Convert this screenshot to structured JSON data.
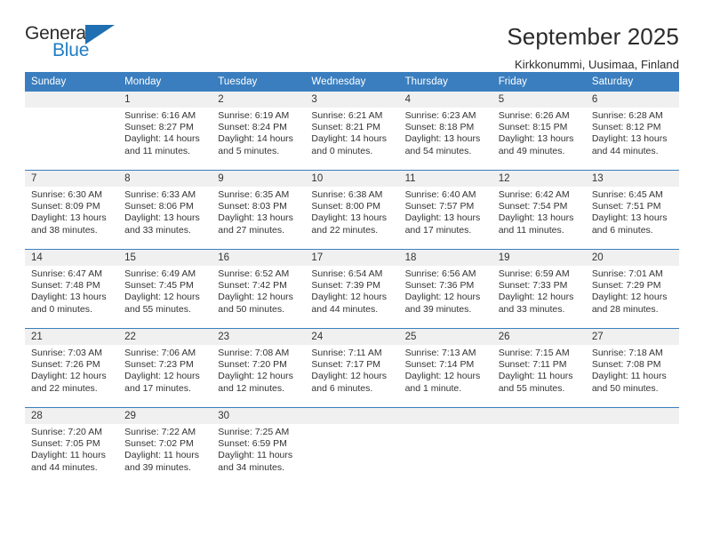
{
  "brand": {
    "name_part1": "General",
    "name_part2": "Blue"
  },
  "header": {
    "title": "September 2025",
    "subtitle": "Kirkkonummi, Uusimaa, Finland"
  },
  "calendar": {
    "weekday_headers": [
      "Sunday",
      "Monday",
      "Tuesday",
      "Wednesday",
      "Thursday",
      "Friday",
      "Saturday"
    ],
    "colors": {
      "header_background": "#3a7ebf",
      "header_text": "#ffffff",
      "daynum_background": "#f0f0f0",
      "accent": "#1f7dc4"
    },
    "labels": {
      "sunrise_prefix": "Sunrise:",
      "sunset_prefix": "Sunset:",
      "daylight_prefix": "Daylight:"
    },
    "weeks": [
      [
        {
          "day": "",
          "empty": true
        },
        {
          "day": "1",
          "sunrise": "Sunrise: 6:16 AM",
          "sunset": "Sunset: 8:27 PM",
          "daylight_line1": "Daylight: 14 hours",
          "daylight_line2": "and 11 minutes."
        },
        {
          "day": "2",
          "sunrise": "Sunrise: 6:19 AM",
          "sunset": "Sunset: 8:24 PM",
          "daylight_line1": "Daylight: 14 hours",
          "daylight_line2": "and 5 minutes."
        },
        {
          "day": "3",
          "sunrise": "Sunrise: 6:21 AM",
          "sunset": "Sunset: 8:21 PM",
          "daylight_line1": "Daylight: 14 hours",
          "daylight_line2": "and 0 minutes."
        },
        {
          "day": "4",
          "sunrise": "Sunrise: 6:23 AM",
          "sunset": "Sunset: 8:18 PM",
          "daylight_line1": "Daylight: 13 hours",
          "daylight_line2": "and 54 minutes."
        },
        {
          "day": "5",
          "sunrise": "Sunrise: 6:26 AM",
          "sunset": "Sunset: 8:15 PM",
          "daylight_line1": "Daylight: 13 hours",
          "daylight_line2": "and 49 minutes."
        },
        {
          "day": "6",
          "sunrise": "Sunrise: 6:28 AM",
          "sunset": "Sunset: 8:12 PM",
          "daylight_line1": "Daylight: 13 hours",
          "daylight_line2": "and 44 minutes."
        }
      ],
      [
        {
          "day": "7",
          "sunrise": "Sunrise: 6:30 AM",
          "sunset": "Sunset: 8:09 PM",
          "daylight_line1": "Daylight: 13 hours",
          "daylight_line2": "and 38 minutes."
        },
        {
          "day": "8",
          "sunrise": "Sunrise: 6:33 AM",
          "sunset": "Sunset: 8:06 PM",
          "daylight_line1": "Daylight: 13 hours",
          "daylight_line2": "and 33 minutes."
        },
        {
          "day": "9",
          "sunrise": "Sunrise: 6:35 AM",
          "sunset": "Sunset: 8:03 PM",
          "daylight_line1": "Daylight: 13 hours",
          "daylight_line2": "and 27 minutes."
        },
        {
          "day": "10",
          "sunrise": "Sunrise: 6:38 AM",
          "sunset": "Sunset: 8:00 PM",
          "daylight_line1": "Daylight: 13 hours",
          "daylight_line2": "and 22 minutes."
        },
        {
          "day": "11",
          "sunrise": "Sunrise: 6:40 AM",
          "sunset": "Sunset: 7:57 PM",
          "daylight_line1": "Daylight: 13 hours",
          "daylight_line2": "and 17 minutes."
        },
        {
          "day": "12",
          "sunrise": "Sunrise: 6:42 AM",
          "sunset": "Sunset: 7:54 PM",
          "daylight_line1": "Daylight: 13 hours",
          "daylight_line2": "and 11 minutes."
        },
        {
          "day": "13",
          "sunrise": "Sunrise: 6:45 AM",
          "sunset": "Sunset: 7:51 PM",
          "daylight_line1": "Daylight: 13 hours",
          "daylight_line2": "and 6 minutes."
        }
      ],
      [
        {
          "day": "14",
          "sunrise": "Sunrise: 6:47 AM",
          "sunset": "Sunset: 7:48 PM",
          "daylight_line1": "Daylight: 13 hours",
          "daylight_line2": "and 0 minutes."
        },
        {
          "day": "15",
          "sunrise": "Sunrise: 6:49 AM",
          "sunset": "Sunset: 7:45 PM",
          "daylight_line1": "Daylight: 12 hours",
          "daylight_line2": "and 55 minutes."
        },
        {
          "day": "16",
          "sunrise": "Sunrise: 6:52 AM",
          "sunset": "Sunset: 7:42 PM",
          "daylight_line1": "Daylight: 12 hours",
          "daylight_line2": "and 50 minutes."
        },
        {
          "day": "17",
          "sunrise": "Sunrise: 6:54 AM",
          "sunset": "Sunset: 7:39 PM",
          "daylight_line1": "Daylight: 12 hours",
          "daylight_line2": "and 44 minutes."
        },
        {
          "day": "18",
          "sunrise": "Sunrise: 6:56 AM",
          "sunset": "Sunset: 7:36 PM",
          "daylight_line1": "Daylight: 12 hours",
          "daylight_line2": "and 39 minutes."
        },
        {
          "day": "19",
          "sunrise": "Sunrise: 6:59 AM",
          "sunset": "Sunset: 7:33 PM",
          "daylight_line1": "Daylight: 12 hours",
          "daylight_line2": "and 33 minutes."
        },
        {
          "day": "20",
          "sunrise": "Sunrise: 7:01 AM",
          "sunset": "Sunset: 7:29 PM",
          "daylight_line1": "Daylight: 12 hours",
          "daylight_line2": "and 28 minutes."
        }
      ],
      [
        {
          "day": "21",
          "sunrise": "Sunrise: 7:03 AM",
          "sunset": "Sunset: 7:26 PM",
          "daylight_line1": "Daylight: 12 hours",
          "daylight_line2": "and 22 minutes."
        },
        {
          "day": "22",
          "sunrise": "Sunrise: 7:06 AM",
          "sunset": "Sunset: 7:23 PM",
          "daylight_line1": "Daylight: 12 hours",
          "daylight_line2": "and 17 minutes."
        },
        {
          "day": "23",
          "sunrise": "Sunrise: 7:08 AM",
          "sunset": "Sunset: 7:20 PM",
          "daylight_line1": "Daylight: 12 hours",
          "daylight_line2": "and 12 minutes."
        },
        {
          "day": "24",
          "sunrise": "Sunrise: 7:11 AM",
          "sunset": "Sunset: 7:17 PM",
          "daylight_line1": "Daylight: 12 hours",
          "daylight_line2": "and 6 minutes."
        },
        {
          "day": "25",
          "sunrise": "Sunrise: 7:13 AM",
          "sunset": "Sunset: 7:14 PM",
          "daylight_line1": "Daylight: 12 hours",
          "daylight_line2": "and 1 minute."
        },
        {
          "day": "26",
          "sunrise": "Sunrise: 7:15 AM",
          "sunset": "Sunset: 7:11 PM",
          "daylight_line1": "Daylight: 11 hours",
          "daylight_line2": "and 55 minutes."
        },
        {
          "day": "27",
          "sunrise": "Sunrise: 7:18 AM",
          "sunset": "Sunset: 7:08 PM",
          "daylight_line1": "Daylight: 11 hours",
          "daylight_line2": "and 50 minutes."
        }
      ],
      [
        {
          "day": "28",
          "sunrise": "Sunrise: 7:20 AM",
          "sunset": "Sunset: 7:05 PM",
          "daylight_line1": "Daylight: 11 hours",
          "daylight_line2": "and 44 minutes."
        },
        {
          "day": "29",
          "sunrise": "Sunrise: 7:22 AM",
          "sunset": "Sunset: 7:02 PM",
          "daylight_line1": "Daylight: 11 hours",
          "daylight_line2": "and 39 minutes."
        },
        {
          "day": "30",
          "sunrise": "Sunrise: 7:25 AM",
          "sunset": "Sunset: 6:59 PM",
          "daylight_line1": "Daylight: 11 hours",
          "daylight_line2": "and 34 minutes."
        },
        {
          "day": "",
          "empty": true
        },
        {
          "day": "",
          "empty": true
        },
        {
          "day": "",
          "empty": true
        },
        {
          "day": "",
          "empty": true
        }
      ]
    ]
  }
}
